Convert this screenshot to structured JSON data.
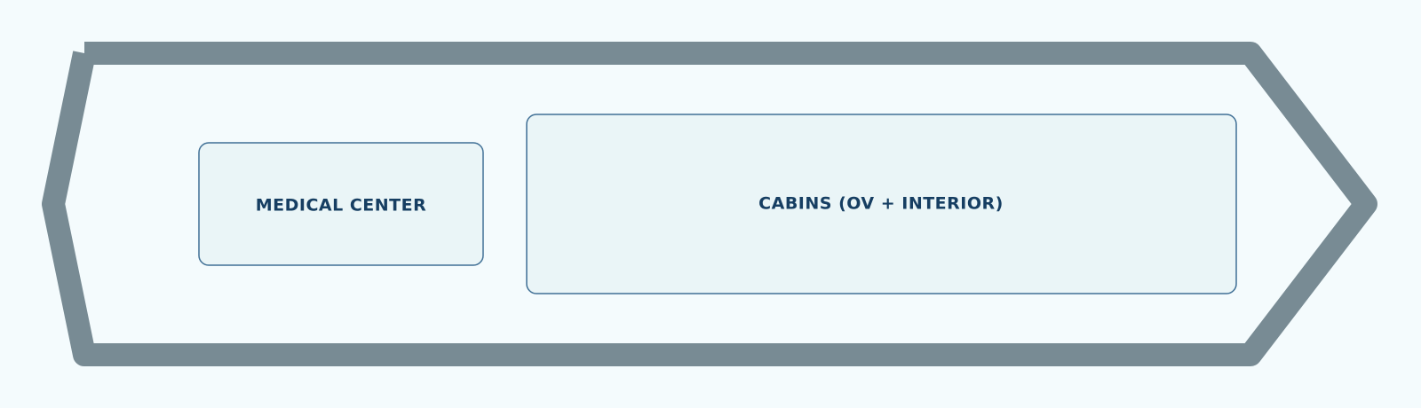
{
  "colors": {
    "background": "#f4fbfd",
    "hull_stroke": "#788b94",
    "hull_fill": "#f4fbfd",
    "block_fill": "#eaf5f7",
    "block_stroke": "#3f6f95",
    "label_text": "#163e62"
  },
  "diagram": {
    "outline": "ship-hull-arrow",
    "blocks": [
      {
        "label": "MEDICAL CENTER"
      },
      {
        "label": "CABINS (OV + INTERIOR)"
      }
    ]
  }
}
